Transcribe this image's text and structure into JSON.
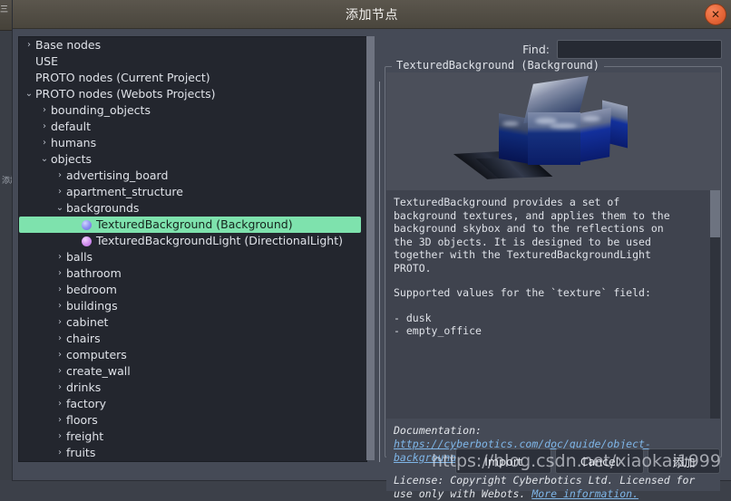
{
  "window": {
    "title": "添加节点",
    "close_icon": "close-icon",
    "close_glyph": "✕"
  },
  "background_app": {
    "sliver_text": "三",
    "mini_text": "添加"
  },
  "tree": [
    {
      "label": "Base nodes",
      "depth": 0,
      "arrow": "collapsed",
      "icon": "none",
      "selected": false
    },
    {
      "label": "USE",
      "depth": 0,
      "arrow": "none",
      "icon": "none",
      "selected": false
    },
    {
      "label": "PROTO nodes (Current Project)",
      "depth": 0,
      "arrow": "none",
      "icon": "none",
      "selected": false
    },
    {
      "label": "PROTO nodes (Webots Projects)",
      "depth": 0,
      "arrow": "expanded",
      "icon": "none",
      "selected": false
    },
    {
      "label": "bounding_objects",
      "depth": 1,
      "arrow": "collapsed",
      "icon": "none",
      "selected": false
    },
    {
      "label": "default",
      "depth": 1,
      "arrow": "collapsed",
      "icon": "none",
      "selected": false
    },
    {
      "label": "humans",
      "depth": 1,
      "arrow": "collapsed",
      "icon": "none",
      "selected": false
    },
    {
      "label": "objects",
      "depth": 1,
      "arrow": "expanded",
      "icon": "none",
      "selected": false
    },
    {
      "label": "advertising_board",
      "depth": 2,
      "arrow": "collapsed",
      "icon": "none",
      "selected": false
    },
    {
      "label": "apartment_structure",
      "depth": 2,
      "arrow": "collapsed",
      "icon": "none",
      "selected": false
    },
    {
      "label": "backgrounds",
      "depth": 2,
      "arrow": "expanded",
      "icon": "none",
      "selected": false
    },
    {
      "label": "TexturedBackground (Background)",
      "depth": 3,
      "arrow": "none",
      "icon": "background-dot",
      "selected": true
    },
    {
      "label": "TexturedBackgroundLight (DirectionalLight)",
      "depth": 3,
      "arrow": "none",
      "icon": "light-dot",
      "selected": false
    },
    {
      "label": "balls",
      "depth": 2,
      "arrow": "collapsed",
      "icon": "none",
      "selected": false
    },
    {
      "label": "bathroom",
      "depth": 2,
      "arrow": "collapsed",
      "icon": "none",
      "selected": false
    },
    {
      "label": "bedroom",
      "depth": 2,
      "arrow": "collapsed",
      "icon": "none",
      "selected": false
    },
    {
      "label": "buildings",
      "depth": 2,
      "arrow": "collapsed",
      "icon": "none",
      "selected": false
    },
    {
      "label": "cabinet",
      "depth": 2,
      "arrow": "collapsed",
      "icon": "none",
      "selected": false
    },
    {
      "label": "chairs",
      "depth": 2,
      "arrow": "collapsed",
      "icon": "none",
      "selected": false
    },
    {
      "label": "computers",
      "depth": 2,
      "arrow": "collapsed",
      "icon": "none",
      "selected": false
    },
    {
      "label": "create_wall",
      "depth": 2,
      "arrow": "collapsed",
      "icon": "none",
      "selected": false
    },
    {
      "label": "drinks",
      "depth": 2,
      "arrow": "collapsed",
      "icon": "none",
      "selected": false
    },
    {
      "label": "factory",
      "depth": 2,
      "arrow": "collapsed",
      "icon": "none",
      "selected": false
    },
    {
      "label": "floors",
      "depth": 2,
      "arrow": "collapsed",
      "icon": "none",
      "selected": false
    },
    {
      "label": "freight",
      "depth": 2,
      "arrow": "collapsed",
      "icon": "none",
      "selected": false
    },
    {
      "label": "fruits",
      "depth": 2,
      "arrow": "collapsed",
      "icon": "none",
      "selected": false
    }
  ],
  "find": {
    "label": "Find:",
    "value": "",
    "placeholder": ""
  },
  "details": {
    "groupbox_title": "TexturedBackground (Background)",
    "preview_alt": "unfolded skybox cube preview",
    "description": "TexturedBackground provides a set of\nbackground textures, and applies them to the\nbackground skybox and to the reflections on\nthe 3D objects. It is designed to be used\ntogether with the TexturedBackgroundLight\nPROTO.",
    "supported_heading": "Supported values for the `texture` field:",
    "supported_values": "- dusk\n- empty_office",
    "documentation_label": "Documentation: ",
    "documentation_link": "https://cyberbotics.com/doc/guide/object-backgrounds",
    "license_text": "License: Copyright Cyberbotics Ltd. Licensed for use only with Webots. ",
    "license_link": "More information."
  },
  "footer": {
    "import_label": "Import",
    "cancel_label": "Cancel",
    "add_label": "添加"
  },
  "watermark": {
    "text": "https://blog.csdn.net/xiaokai1999"
  },
  "colors": {
    "dialog_bg": "#454a56",
    "tree_bg": "#23262e",
    "selection_green": "#7ee2ad",
    "link_blue": "#7fb6e8",
    "close_orange": "#e8693a"
  }
}
